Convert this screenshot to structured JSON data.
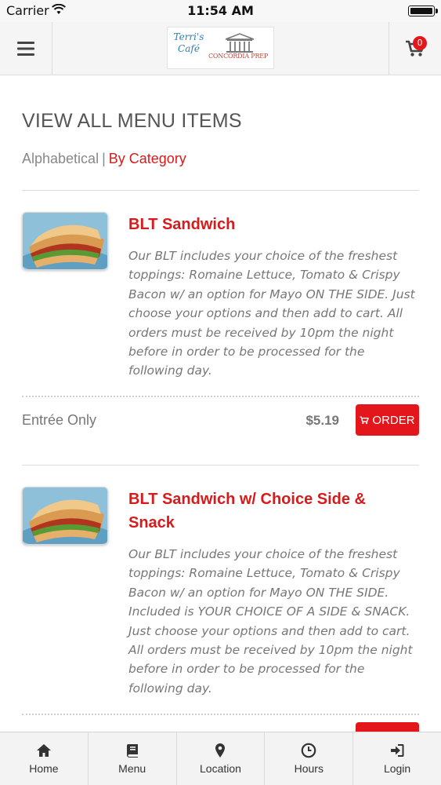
{
  "status_bar": {
    "carrier": "Carrier",
    "time": "11:54 AM"
  },
  "header": {
    "logo_text_1": "Terri's Café",
    "logo_text_2": "CONCORDIA PREP",
    "cart_count": "0"
  },
  "page": {
    "title": "VIEW ALL MENU ITEMS",
    "sort_alphabetical": "Alphabetical",
    "sort_separator": "|",
    "sort_by_category": "By Category"
  },
  "menu_items": [
    {
      "name": "BLT Sandwich",
      "description": "Our BLT includes your choice of the freshest toppings: Romaine Lettuce, Tomato & Crispy Bacon w/ an option for Mayo ON THE SIDE. Just choose your options and then add to cart. All orders must be received by 10pm the night before in order to be processed for the following day.",
      "option_label": "Entrée Only",
      "price": "$5.19",
      "order_label": "ORDER"
    },
    {
      "name": "BLT Sandwich w/ Choice Side & Snack",
      "description": "Our BLT includes your choice of the freshest toppings: Romaine Lettuce, Tomato & Crispy Bacon w/ an option for Mayo ON THE SIDE. Included is YOUR CHOICE OF A SIDE & SNACK. Just choose your options and then add to cart. All orders must be received by 10pm the night before in order to be processed for the following day."
    }
  ],
  "tabs": [
    {
      "label": "Home",
      "icon": "home-icon"
    },
    {
      "label": "Menu",
      "icon": "book-icon"
    },
    {
      "label": "Location",
      "icon": "map-pin-icon"
    },
    {
      "label": "Hours",
      "icon": "clock-icon"
    },
    {
      "label": "Login",
      "icon": "login-icon"
    }
  ],
  "colors": {
    "accent": "#e3161b",
    "link_active": "#d51b1b"
  }
}
